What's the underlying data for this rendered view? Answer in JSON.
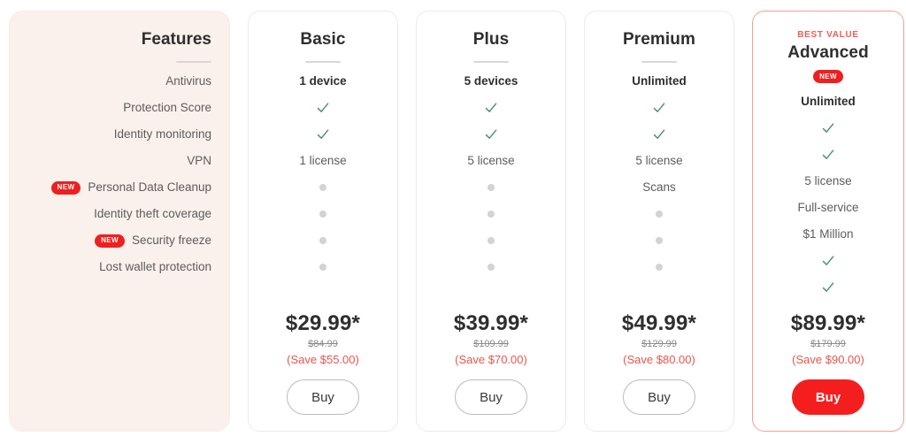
{
  "features_card": {
    "title": "Features",
    "rows": [
      {
        "label": "Antivirus",
        "badge": null
      },
      {
        "label": "Protection Score",
        "badge": null
      },
      {
        "label": "Identity monitoring",
        "badge": null
      },
      {
        "label": "VPN",
        "badge": null
      },
      {
        "label": "Personal Data Cleanup",
        "badge": "NEW"
      },
      {
        "label": "Identity theft coverage",
        "badge": null
      },
      {
        "label": "Security freeze",
        "badge": "NEW"
      },
      {
        "label": "Lost wallet protection",
        "badge": null
      }
    ]
  },
  "plans": [
    {
      "name": "Basic",
      "eyebrow": null,
      "badge": null,
      "values": [
        "1 device",
        "check",
        "check",
        "1 license",
        "dot",
        "dot",
        "dot",
        "dot"
      ],
      "price": "$29.99*",
      "was": "$84.99",
      "save": "(Save $55.00)",
      "buy_label": "Buy",
      "highlight": false
    },
    {
      "name": "Plus",
      "eyebrow": null,
      "badge": null,
      "values": [
        "5 devices",
        "check",
        "check",
        "5 license",
        "dot",
        "dot",
        "dot",
        "dot"
      ],
      "price": "$39.99*",
      "was": "$109.99",
      "save": "(Save $70.00)",
      "buy_label": "Buy",
      "highlight": false
    },
    {
      "name": "Premium",
      "eyebrow": null,
      "badge": null,
      "values": [
        "Unlimited",
        "check",
        "check",
        "5 license",
        "Scans",
        "dot",
        "dot",
        "dot"
      ],
      "price": "$49.99*",
      "was": "$129.99",
      "save": "(Save $80.00)",
      "buy_label": "Buy",
      "highlight": false
    },
    {
      "name": "Advanced",
      "eyebrow": "BEST VALUE",
      "badge": "NEW",
      "values": [
        "Unlimited",
        "check",
        "check",
        "5 license",
        "Full-service",
        "$1 Million",
        "check",
        "check"
      ],
      "price": "$89.99*",
      "was": "$179.99",
      "save": "(Save $90.00)",
      "buy_label": "Buy",
      "highlight": true
    }
  ],
  "colors": {
    "features_bg": "#fbf1ec",
    "accent_red": "#f51e1e",
    "eyebrow_red": "#f25c54",
    "save_red": "#e8564a",
    "check_green": "#4e9080",
    "dot_gray": "#d4d2d2",
    "highlight_border": "#f0a193"
  }
}
